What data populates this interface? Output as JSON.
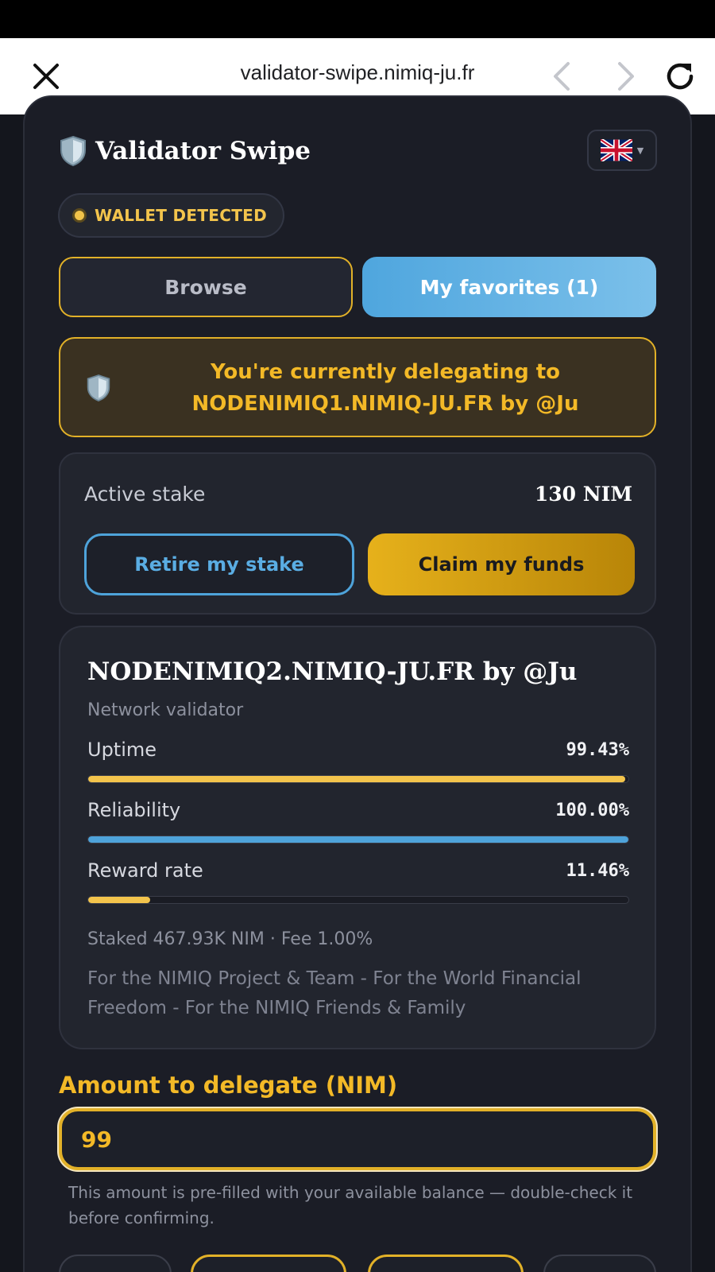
{
  "browser": {
    "url": "validator-swipe.nimiq-ju.fr"
  },
  "app": {
    "title": "Validator Swipe",
    "wallet_status": "WALLET DETECTED"
  },
  "tabs": {
    "browse": "Browse",
    "favorites": "My favorites (1)"
  },
  "delegation": {
    "message": "You're currently delegating to NODENIMIQ1.NIMIQ-JU.FR by @Ju"
  },
  "stake": {
    "label": "Active stake",
    "value": "130 NIM",
    "retire_label": "Retire my stake",
    "claim_label": "Claim my funds"
  },
  "validator": {
    "name": "NODENIMIQ2.NIMIQ-JU.FR by @Ju",
    "type": "Network validator",
    "metrics": [
      {
        "label": "Uptime",
        "value": "99.43%",
        "percent": 99.43,
        "color": "#f3c44c"
      },
      {
        "label": "Reliability",
        "value": "100.00%",
        "percent": 100,
        "color": "#4ea3da"
      },
      {
        "label": "Reward rate",
        "value": "11.46%",
        "percent": 11.46,
        "color": "#f3c44c"
      }
    ],
    "staked_info": "Staked 467.93K NIM · Fee 1.00%",
    "description": "For the NIMIQ Project & Team - For the World Financial Freedom - For the NIMIQ Friends & Family"
  },
  "amount": {
    "label": "Amount to delegate (NIM)",
    "value": "99",
    "hint": "This amount is pre-filled with your available balance — double-check it before confirming."
  },
  "colors": {
    "accent_gold": "#e2b128",
    "accent_blue": "#4ea3da",
    "panel_bg": "#1b1d26"
  }
}
